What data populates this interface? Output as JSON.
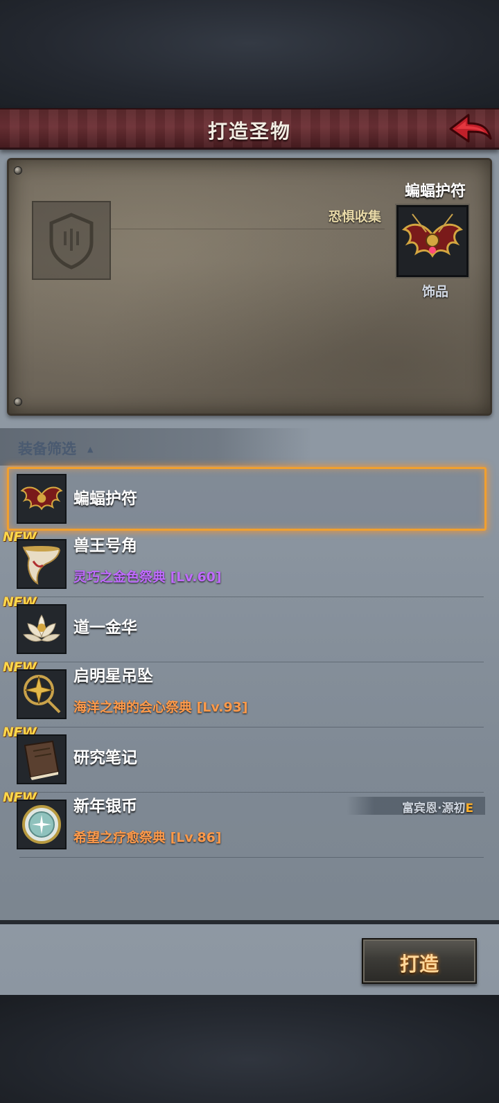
{
  "header": {
    "title": "打造圣物",
    "back_icon": "red-arrow-back-icon"
  },
  "preview": {
    "collection_label": "恐惧收集",
    "result_name": "蝙蝠护符",
    "result_type": "饰品",
    "empty_slot_icon": "shield-icon"
  },
  "filter": {
    "label": "装备筛选",
    "caret": "▲"
  },
  "items": [
    {
      "name": "蝙蝠护符",
      "sub": "",
      "new": "",
      "icon": "bat-amulet-icon",
      "selected": true
    },
    {
      "name": "兽王号角",
      "sub": "灵巧之金色祭典 [Lv.60]",
      "sub_color": "#c06bff",
      "new": "NEW",
      "icon": "horn-icon"
    },
    {
      "name": "道一金华",
      "sub": "",
      "new": "NEW",
      "icon": "lotus-icon"
    },
    {
      "name": "启明星吊坠",
      "sub": "海洋之神的会心祭典 [Lv.93]",
      "sub_color": "#ff9a4a",
      "new": "NEW",
      "icon": "star-pendant-icon"
    },
    {
      "name": "研究笔记",
      "sub": "",
      "new": "NEW",
      "icon": "notebook-icon"
    },
    {
      "name": "新年银币",
      "sub": "希望之疗愈祭典 [Lv.86]",
      "sub_color": "#ff9a4a",
      "new": "NEW",
      "icon": "silver-coin-icon"
    }
  ],
  "owner_tag": {
    "name": "富宾恩·源初",
    "rank": "E"
  },
  "craft_button": {
    "label": "打造"
  }
}
